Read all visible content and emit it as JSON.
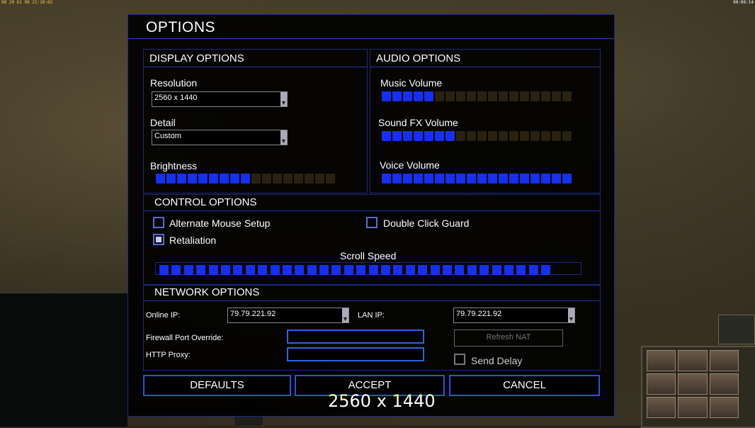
{
  "hud": {
    "top_left": "08 20 61 99 21:10:02",
    "top_right": "00:00:14"
  },
  "dialog": {
    "title": "OPTIONS"
  },
  "display": {
    "heading": "DISPLAY OPTIONS",
    "resolution_label": "Resolution",
    "resolution_value": "2560 x 1440",
    "detail_label": "Detail",
    "detail_value": "Custom",
    "brightness_label": "Brightness",
    "brightness_level": 0.53
  },
  "audio": {
    "heading": "AUDIO OPTIONS",
    "music_label": "Music Volume",
    "music_level": 0.28,
    "sfx_label": "Sound FX Volume",
    "sfx_level": 0.39,
    "voice_label": "Voice Volume",
    "voice_level": 1.0
  },
  "control": {
    "heading": "CONTROL OPTIONS",
    "alt_mouse_label": "Alternate Mouse Setup",
    "alt_mouse_checked": false,
    "double_click_label": "Double Click Guard",
    "double_click_checked": false,
    "retaliation_label": "Retaliation",
    "retaliation_checked": true,
    "scroll_label": "Scroll Speed",
    "scroll_level": 1.0
  },
  "network": {
    "heading": "NETWORK OPTIONS",
    "online_ip_label": "Online IP:",
    "online_ip_value": "79.79.221.92",
    "lan_ip_label": "LAN IP:",
    "lan_ip_value": "79.79.221.92",
    "firewall_label": "Firewall Port Override:",
    "http_proxy_label": "HTTP Proxy:",
    "refresh_nat_label": "Refresh NAT",
    "send_delay_label": "Send Delay",
    "send_delay_checked": false
  },
  "buttons": {
    "defaults": "DEFAULTS",
    "accept": "ACCEPT",
    "cancel": "CANCEL"
  },
  "overlay": {
    "resolution_text": "2560 x 1440"
  },
  "colors": {
    "accent": "#1530f0",
    "border": "#2a52e0",
    "slider_off": "#2a2210"
  }
}
